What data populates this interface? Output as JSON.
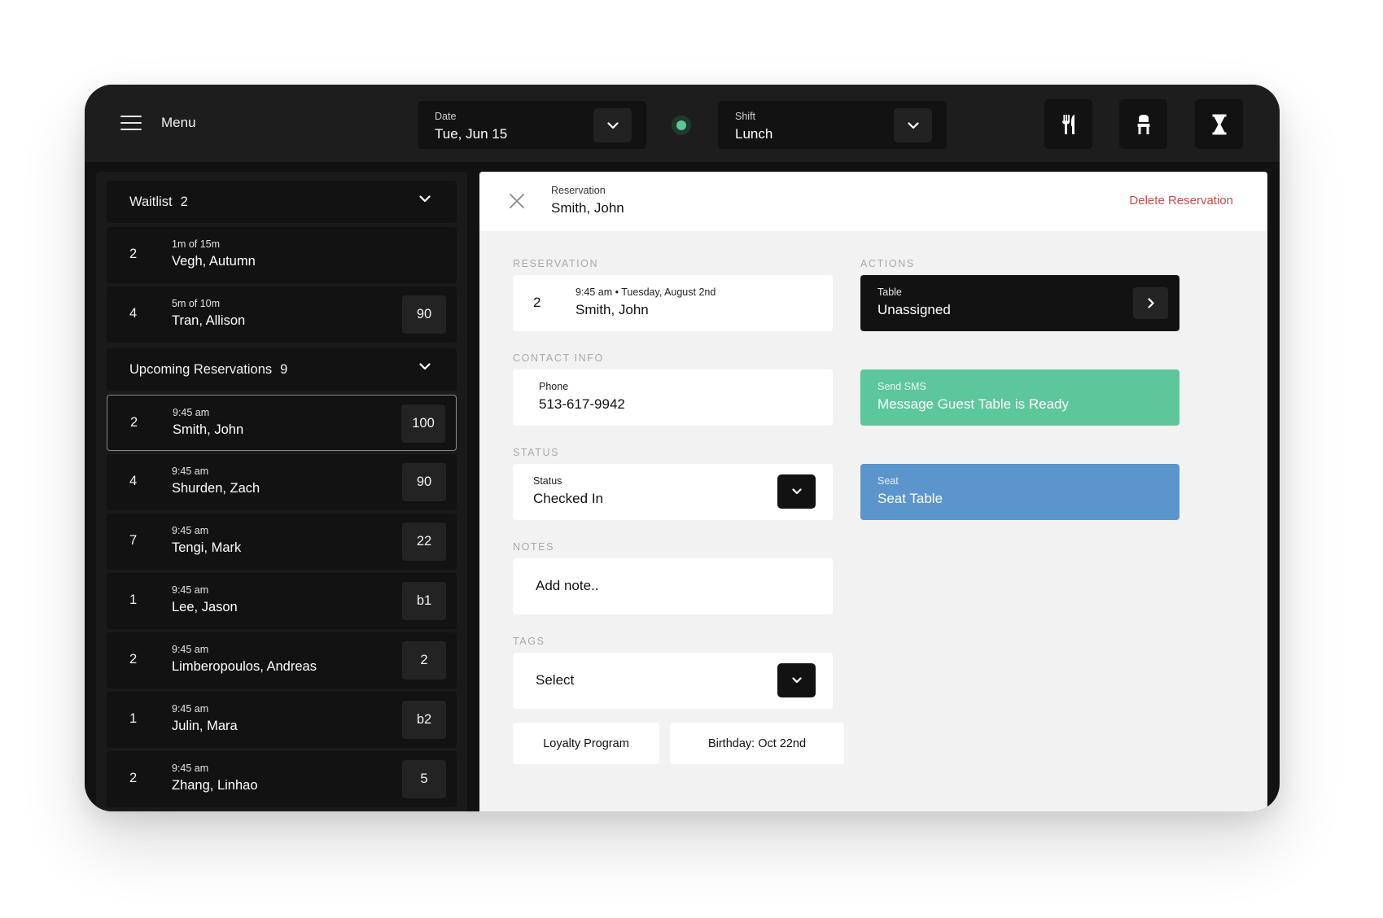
{
  "topbar": {
    "menu_label": "Menu",
    "date": {
      "label": "Date",
      "value": "Tue, Jun 15"
    },
    "shift": {
      "label": "Shift",
      "value": "Lunch"
    },
    "status_color": "#5ec69a",
    "icons": [
      "utensils-icon",
      "chair-icon",
      "hourglass-icon"
    ]
  },
  "waitlist": {
    "title": "Waitlist",
    "count": "2",
    "items": [
      {
        "party": "2",
        "time": "1m  of  15m",
        "name": "Vegh, Autumn",
        "table": ""
      },
      {
        "party": "4",
        "time": "5m  of  10m",
        "name": "Tran, Allison",
        "table": "90"
      }
    ]
  },
  "upcoming": {
    "title": "Upcoming Reservations",
    "count": "9",
    "items": [
      {
        "party": "2",
        "time": "9:45 am",
        "name": "Smith, John",
        "table": "100"
      },
      {
        "party": "4",
        "time": "9:45 am",
        "name": "Shurden, Zach",
        "table": "90"
      },
      {
        "party": "7",
        "time": "9:45 am",
        "name": "Tengi, Mark",
        "table": "22"
      },
      {
        "party": "1",
        "time": "9:45 am",
        "name": "Lee, Jason",
        "table": "b1"
      },
      {
        "party": "2",
        "time": "9:45 am",
        "name": "Limberopoulos, Andreas",
        "table": "2"
      },
      {
        "party": "1",
        "time": "9:45 am",
        "name": "Julin, Mara",
        "table": "b2"
      },
      {
        "party": "2",
        "time": "9:45 am",
        "name": "Zhang, Linhao",
        "table": "5"
      }
    ]
  },
  "detail": {
    "header_label": "Reservation",
    "header_name": "Smith, John",
    "delete_label": "Delete Reservation",
    "reservation_section": "RESERVATION",
    "reservation": {
      "party": "2",
      "datetime": "9:45 am • Tuesday, August 2nd",
      "name": "Smith, John"
    },
    "contact_section": "CONTACT INFO",
    "phone_label": "Phone",
    "phone_value": "513-617-9942",
    "status_section": "STATUS",
    "status_label": "Status",
    "status_value": "Checked In",
    "notes_section": "NOTES",
    "notes_placeholder": "Add note..",
    "tags_section": "TAGS",
    "tags_select": "Select",
    "tags": [
      "Loyalty Program",
      "Birthday: Oct 22nd"
    ],
    "actions_section": "ACTIONS",
    "table_action": {
      "label": "Table",
      "value": "Unassigned"
    },
    "sms_action": {
      "label": "Send SMS",
      "value": "Message Guest Table is Ready"
    },
    "seat_action": {
      "label": "Seat",
      "value": "Seat Table"
    }
  },
  "colors": {
    "sms": "#5cc79b",
    "seat": "#5b95cc",
    "delete": "#d24a4a"
  }
}
